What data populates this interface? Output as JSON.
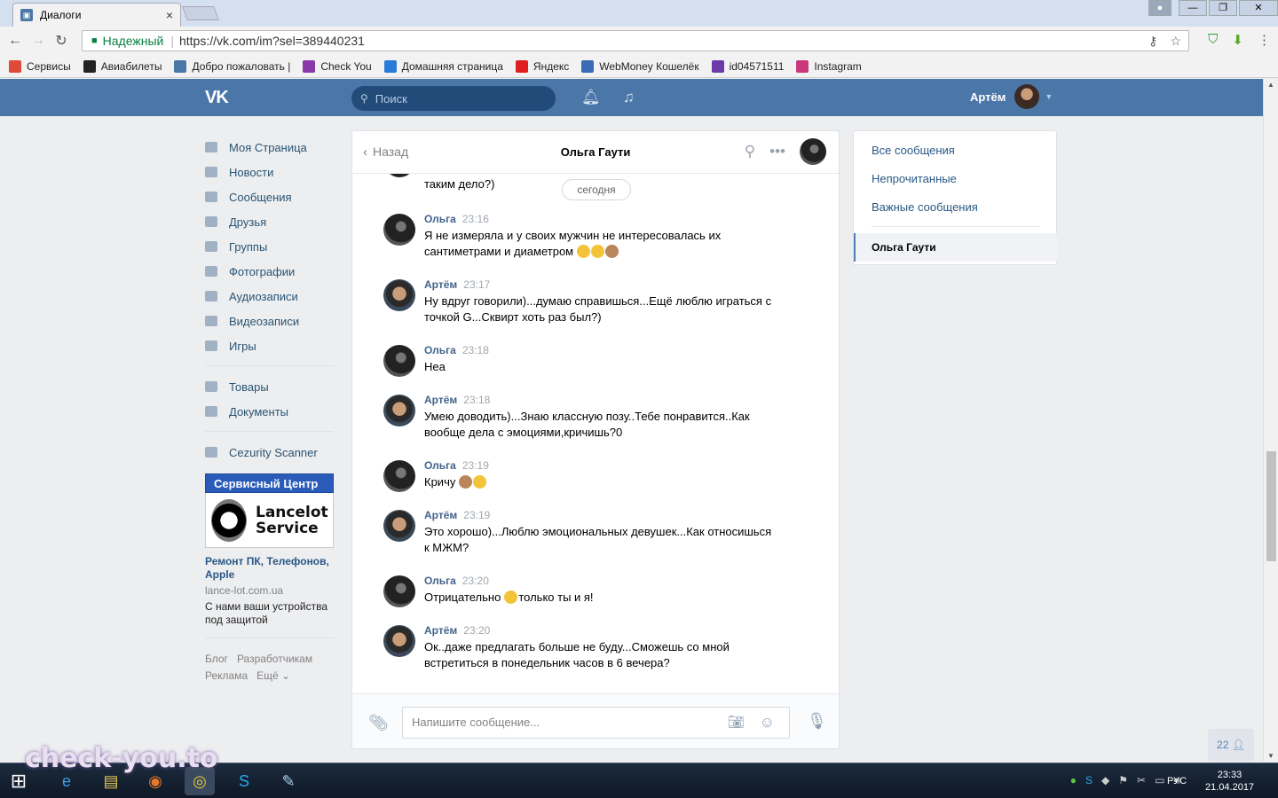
{
  "browser": {
    "tab_title": "Диалоги",
    "tab_close": "×",
    "secure_label": "Надежный",
    "url": "https://vk.com/im?sel=389440231",
    "win_min": "—",
    "win_max": "❐",
    "win_close": "✕"
  },
  "bookmarks": [
    {
      "label": "Сервисы",
      "color": "#e04a3a"
    },
    {
      "label": "Авиабилеты",
      "color": "#222222"
    },
    {
      "label": "Добро пожаловать |",
      "color": "#4a76a8"
    },
    {
      "label": "Check You",
      "color": "#8a3aa8"
    },
    {
      "label": "Домашняя страница",
      "color": "#2a7ad8"
    },
    {
      "label": "Яндекс",
      "color": "#e02020"
    },
    {
      "label": "WebMoney Кошелёк",
      "color": "#3a6ab8"
    },
    {
      "label": "id04571511",
      "color": "#6a3aa8"
    },
    {
      "label": "Instagram",
      "color": "#c8387a"
    }
  ],
  "vk": {
    "logo": "VK",
    "search_placeholder": "Поиск",
    "user_name": "Артём"
  },
  "left_menu": {
    "items": [
      "Моя Страница",
      "Новости",
      "Сообщения",
      "Друзья",
      "Группы",
      "Фотографии",
      "Аудиозаписи",
      "Видеозаписи",
      "Игры"
    ],
    "items2": [
      "Товары",
      "Документы"
    ],
    "items3": [
      "Cezurity Scanner"
    ]
  },
  "ad": {
    "title": "Сервисный Центр",
    "brand_line1": "Lancelot",
    "brand_line2": "Service",
    "headline": "Ремонт ПК, Телефонов, Apple",
    "site": "lance-lot.com.ua",
    "desc": "С нами ваши устройства под защитой"
  },
  "footer": {
    "blog": "Блог",
    "dev": "Разработчикам",
    "ads": "Реклама",
    "more": "Ещё ⌄"
  },
  "chat": {
    "back_label": "Назад",
    "title": "Ольга Гаути",
    "partial_text": "таким дело?)",
    "date_pill": "сегодня",
    "messages": [
      {
        "author": "Ольга",
        "time": "23:16",
        "text": "Я не измеряла и у своих мужчин не интересовалась их сантиметрами и диаметром"
      },
      {
        "author": "Артём",
        "time": "23:17",
        "text": "Ну вдруг говорили)...думаю справишься...Ещё люблю играться с точкой G...Сквирт хоть раз был?)"
      },
      {
        "author": "Ольга",
        "time": "23:18",
        "text": "Неа"
      },
      {
        "author": "Артём",
        "time": "23:18",
        "text": "Умею доводить)...Знаю классную позу..Тебе понравится..Как вообще дела с эмоциями,кричишь?0"
      },
      {
        "author": "Ольга",
        "time": "23:19",
        "text": "Кричу"
      },
      {
        "author": "Артём",
        "time": "23:19",
        "text": "Это хорошо)...Люблю эмоциональных девушек...Как относишься к МЖМ?"
      },
      {
        "author": "Ольга",
        "time": "23:20",
        "text_a": "Отрицательно",
        "text_b": "только ты и я!"
      },
      {
        "author": "Артём",
        "time": "23:20",
        "text": "Ок..даже предлагать больше не буду...Сможешь со мной встретиться в понедельник часов в 6 вечера?"
      }
    ],
    "input_placeholder": "Напишите сообщение..."
  },
  "filters": {
    "all": "Все сообщения",
    "unread": "Непрочитанные",
    "important": "Важные сообщения",
    "selected": "Ольга Гаути"
  },
  "online_count": "22",
  "taskbar": {
    "lang": "РУС",
    "time": "23:33",
    "date": "21.04.2017"
  },
  "watermark": "check-you.to"
}
